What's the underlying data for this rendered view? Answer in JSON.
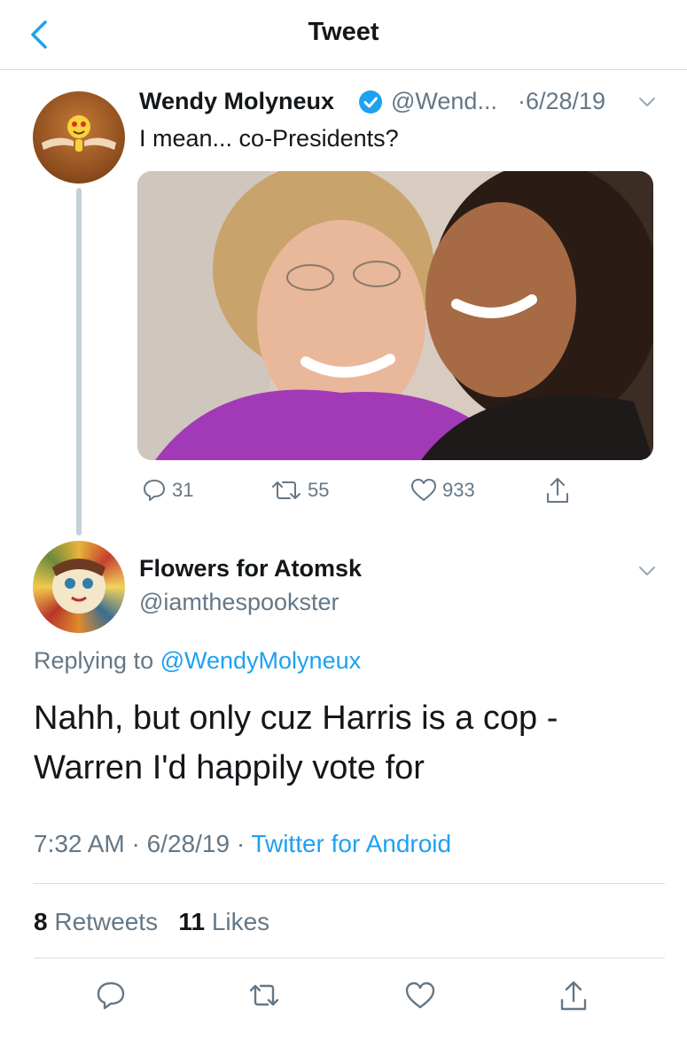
{
  "header": {
    "title": "Tweet"
  },
  "original": {
    "name": "Wendy Molyneux",
    "handle": "@Wend...",
    "date": "·6/28/19",
    "text": "I mean... co-Presidents?",
    "counts": {
      "replies": "31",
      "retweets": "55",
      "likes": "933"
    }
  },
  "reply": {
    "name": "Flowers for Atomsk",
    "handle": "@iamthespookster",
    "replying_prefix": "Replying to ",
    "replying_handle": "@WendyMolyneux",
    "text": "Nahh, but only cuz Harris is a cop - Warren I'd happily vote for",
    "time": "7:32 AM · 6/28/19 · ",
    "source": "Twitter for Android"
  },
  "stats": {
    "retweets_count": "8",
    "retweets_label": "Retweets",
    "likes_count": "11",
    "likes_label": "Likes"
  },
  "colors": {
    "accent": "#1da1f2",
    "muted": "#657786",
    "text": "#14171a",
    "verified": "#1da1f2",
    "divider": "#d8dde1"
  },
  "icons": [
    "back-chevron-icon",
    "verified-badge-icon",
    "chevron-down-icon",
    "reply-icon",
    "retweet-icon",
    "heart-icon",
    "share-icon"
  ]
}
